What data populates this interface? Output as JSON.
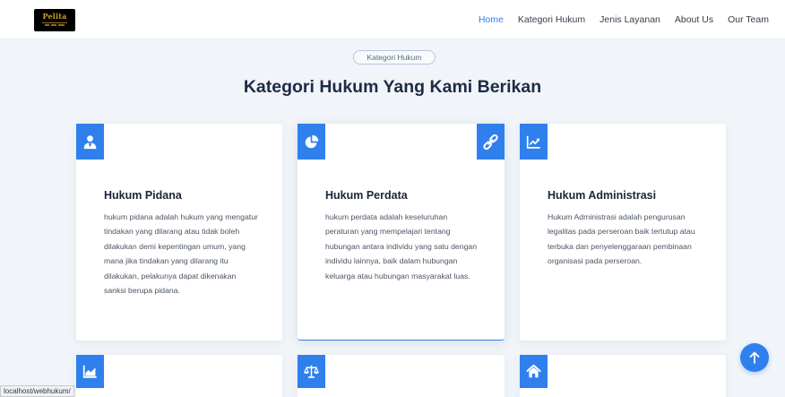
{
  "brand": {
    "logo_text": "Pelita"
  },
  "nav": {
    "items": [
      {
        "label": "Home",
        "active": true
      },
      {
        "label": "Kategori Hukum",
        "active": false
      },
      {
        "label": "Jenis Layanan",
        "active": false
      },
      {
        "label": "About Us",
        "active": false
      },
      {
        "label": "Our Team",
        "active": false
      }
    ]
  },
  "section": {
    "badge": "Kategori Hukum",
    "title": "Kategori Hukum Yang Kami Berikan"
  },
  "cards": [
    {
      "title": "Hukum Pidana",
      "text": "hukum pidana adalah hukum yang mengatur tindakan yang dilarang atau tidak boleh dilakukan demi kepentingan umum, yang mana jika tindakan yang dilarang itu dilakukan, pelakunya dapat dikenakan sanksi berupa pidana.",
      "icon": "user-tie-icon"
    },
    {
      "title": "Hukum Perdata",
      "text": "hukum perdata adalah keseluruhan peraturan yang mempelajari tentang hubungan antara individu yang satu dengan individu lainnya, baik dalam hubungan keluarga atau hubungan masyarakat luas.",
      "icon": "pie-chart-icon",
      "secondary_icon": "link-icon"
    },
    {
      "title": "Hukum Administrasi",
      "text": "Hukum Administrasi adalah pengurusan legalitas pada perseroan baik tertutup atau terbuka dan penyelenggaraan pembinaan organisasi pada perseroan.",
      "icon": "line-chart-icon"
    }
  ],
  "next_row_icons": [
    "area-chart-icon",
    "balance-scale-icon",
    "home-icon"
  ],
  "status_url": "localhost/webhukum/",
  "colors": {
    "accent": "#2f80ed",
    "background": "#f1f5f9",
    "title": "#1d2b44"
  }
}
